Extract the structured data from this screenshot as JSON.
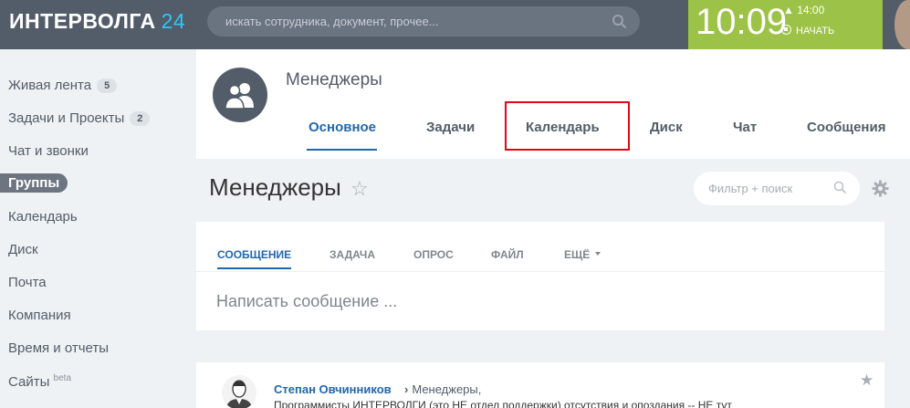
{
  "header": {
    "logo_main": "ИНТЕРВОЛГА",
    "logo_accent": "24",
    "search_placeholder": "искать сотрудника, документ, прочее...",
    "clock": "10:09",
    "alarm_time": "14:00",
    "start_label": "НАЧАТЬ"
  },
  "sidebar": {
    "items": [
      {
        "label": "Живая лента",
        "counter": "5"
      },
      {
        "label": "Задачи и Проекты",
        "counter": "2"
      },
      {
        "label": "Чат и звонки"
      },
      {
        "label": "Группы",
        "active": true
      },
      {
        "label": "Календарь"
      },
      {
        "label": "Диск"
      },
      {
        "label": "Почта"
      },
      {
        "label": "Компания"
      },
      {
        "label": "Время и отчеты"
      },
      {
        "label": "Сайты",
        "sup": "beta"
      }
    ]
  },
  "group": {
    "name": "Менеджеры",
    "tabs": [
      {
        "label": "Основное",
        "active": true
      },
      {
        "label": "Задачи"
      },
      {
        "label": "Календарь",
        "highlighted": true
      },
      {
        "label": "Диск"
      },
      {
        "label": "Чат"
      },
      {
        "label": "Сообщения"
      }
    ]
  },
  "page": {
    "title": "Менеджеры",
    "filter_placeholder": "Фильтр + поиск"
  },
  "post_form": {
    "tabs": [
      "СООБЩЕНИЕ",
      "ЗАДАЧА",
      "ОПРОС",
      "ФАЙЛ",
      "ЕЩЁ"
    ],
    "compose_placeholder": "Написать сообщение ..."
  },
  "feed": {
    "author": "Степан Овчинников",
    "destination": "Менеджеры,",
    "text": "Программисты ИНТЕРВОЛГИ (это НЕ отдел поддержки) отсутствия и опоздания -- НЕ тут"
  },
  "colors": {
    "topbar": "#535c69",
    "clock_bg": "#9cc247",
    "accent": "#2067b0",
    "highlight": "#e30613"
  }
}
